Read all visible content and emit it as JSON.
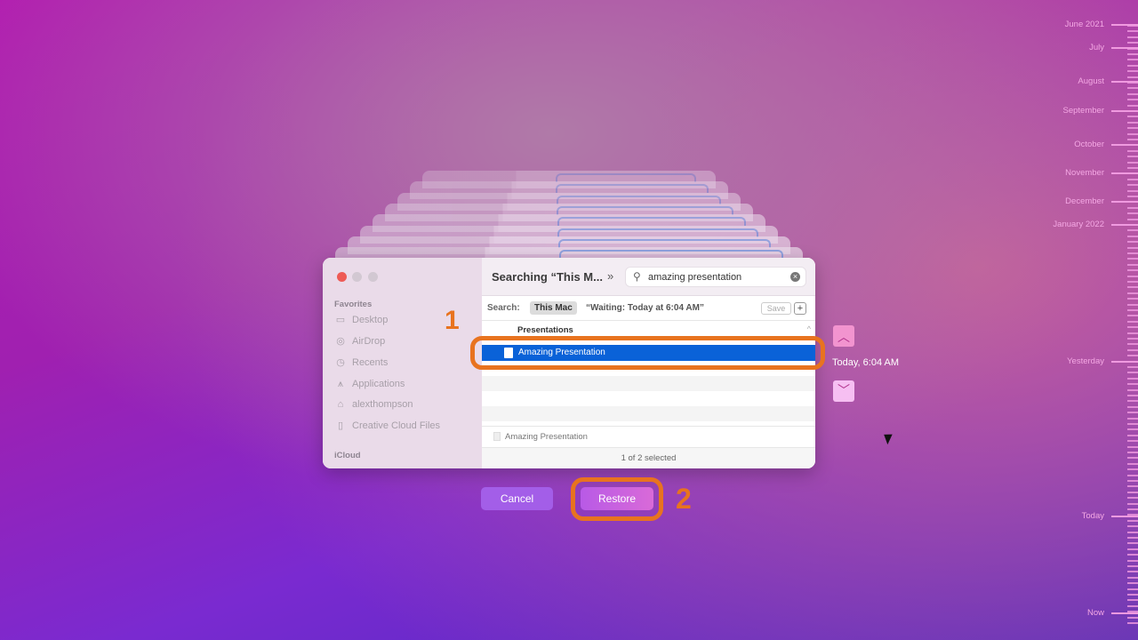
{
  "finder": {
    "title": "Searching “This M...",
    "search_value": "amazing presentation",
    "search_label": "Search:",
    "scope": "This Mac",
    "scope_alt": "“Waiting: Today at 6:04 AM”",
    "save_label": "Save",
    "add_label": "+",
    "group_header": "Presentations",
    "selected_file": "Amazing Presentation",
    "preview_file": "Amazing Presentation",
    "status": "1 of 2 selected",
    "sidebar": {
      "favorites_header": "Favorites",
      "icloud_header": "iCloud",
      "items": [
        {
          "label": "Desktop",
          "icon": "desktop-icon"
        },
        {
          "label": "AirDrop",
          "icon": "airdrop-icon"
        },
        {
          "label": "Recents",
          "icon": "clock-icon"
        },
        {
          "label": "Applications",
          "icon": "applications-icon"
        },
        {
          "label": "alexthompson",
          "icon": "home-icon"
        },
        {
          "label": "Creative Cloud Files",
          "icon": "document-icon"
        }
      ]
    }
  },
  "annotations": {
    "step1": "1",
    "step2": "2",
    "color": "#e8731f"
  },
  "actions": {
    "cancel": "Cancel",
    "restore": "Restore"
  },
  "snapshot": {
    "current": "Today, 6:04 AM"
  },
  "timeline": {
    "labels": [
      "June 2021",
      "July",
      "August",
      "September",
      "October",
      "November",
      "December",
      "January 2022",
      "Yesterday",
      "Today",
      "Now"
    ]
  },
  "colors": {
    "selection": "#0a62d8",
    "cancel": "#a35ee8",
    "restore": "#c25ae0"
  }
}
